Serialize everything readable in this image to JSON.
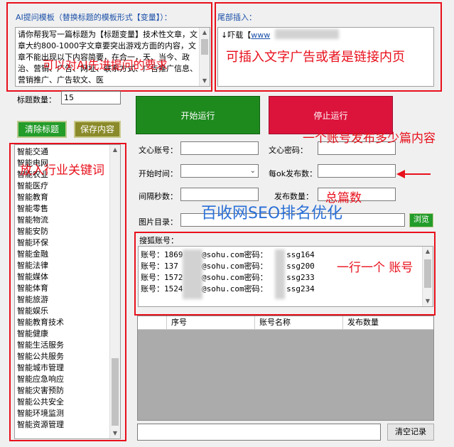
{
  "prompt_template": {
    "label": "AI提问模板（替换标题的模板形式【变量】）：",
    "text": "请你帮我写一篇标题为【标题变量】技术性文章，文章大约800-1000字文章要突出游戏方面的内容，文章不能出现以下内容简要，在合一，天、当今、政治、营销、广告、网址、联系方式、广告推广信息、营销推广、广告软文、医"
  },
  "footer_insert": {
    "label": "尾部插入：",
    "text_prefix": "↓吓载【",
    "link": "www"
  },
  "title_count": {
    "label": "标题数量：",
    "value": "15"
  },
  "buttons": {
    "clear_titles": "清除标题",
    "save_content": "保存内容",
    "start": "开始运行",
    "stop": "停止运行",
    "browse": "浏览",
    "clear_records": "清空记录"
  },
  "keywords": [
    "智能交通",
    "智能电网",
    "智能农业",
    "智能医疗",
    "智能教育",
    "智能零售",
    "智能物流",
    "智能安防",
    "智能环保",
    "智能金融",
    "智能法律",
    "智能媒体",
    "智能体育",
    "智能旅游",
    "智能娱乐",
    "智能教育技术",
    "智能健康",
    "智能生活服务",
    "智能公共服务",
    "智能城市管理",
    "智能应急响应",
    "智能灾害预防",
    "智能公共安全",
    "智能环境监测",
    "智能资源管理"
  ],
  "form": {
    "wenxin_account": "文心账号：",
    "wenxin_password": "文心密码：",
    "start_time": "开始时间：",
    "per_account": "每ok发布数：",
    "interval": "间隔秒数：",
    "publish_count": "发布数量：",
    "image_dir": "图片目录："
  },
  "sohu": {
    "label": "搜狐账号：",
    "accounts": [
      "账号：1869    @sohu.com密码：    ssg164",
      "账号：137     @sohu.com密码：    ssg200",
      "账号：1572    @sohu.com密码：    ssg233",
      "账号：1524    @sohu.com密码：    ssg234"
    ]
  },
  "table": {
    "columns": [
      "序号",
      "账号名称",
      "发布数量"
    ]
  },
  "annotations": {
    "prompt_note": "可以对AI先进提问的要求",
    "footer_note": "可插入文字广告或者是链接内页",
    "per_account_note": "一个账号发布多少篇内容",
    "keywords_note": "放入行业关键词",
    "total_note": "总篇数",
    "watermark": "百收网SEO排名优化",
    "accounts_note": "一行一个 账号"
  },
  "colors": {
    "start_green": "#1e8a1e",
    "stop_red": "#dc143c",
    "annotation_red": "#e8101c",
    "watermark_blue": "#2a6fd6"
  }
}
